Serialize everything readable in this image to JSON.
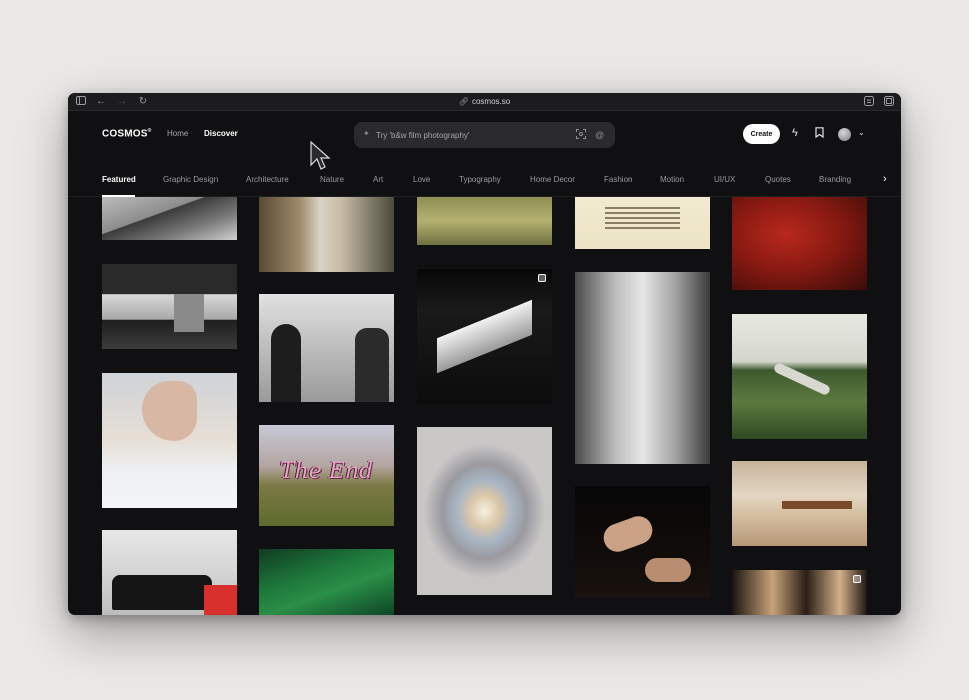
{
  "browser": {
    "url": "cosmos.so",
    "icons": [
      "sidebar-icon",
      "back-arrow-icon",
      "forward-arrow-icon",
      "reload-icon",
      "share-icon",
      "tabs-icon",
      "link-icon"
    ]
  },
  "header": {
    "logo": "COSMOS",
    "logo_mark": "®",
    "nav": [
      {
        "label": "Home",
        "active": false
      },
      {
        "label": "Discover",
        "active": true
      }
    ],
    "search": {
      "placeholder": "Try 'b&w film photography'",
      "icons": [
        "sparkle-icon",
        "image-search-icon",
        "at-sign-icon"
      ]
    },
    "create_label": "Create",
    "icons": [
      "lightning-icon",
      "bookmark-icon",
      "avatar",
      "chevron-down-icon"
    ]
  },
  "tabs": {
    "items": [
      "Featured",
      "Graphic Design",
      "Architecture",
      "Nature",
      "Art",
      "Love",
      "Typography",
      "Home Decor",
      "Fashion",
      "Motion",
      "UI/UX",
      "Quotes",
      "Branding"
    ],
    "active": "Featured",
    "next_icon": "chevron-right-icon"
  },
  "grid": {
    "the_end_text": "The End",
    "colors": {
      "background": "#101012",
      "accent": "#ffffff",
      "end_text": "#e7a3c6"
    }
  }
}
